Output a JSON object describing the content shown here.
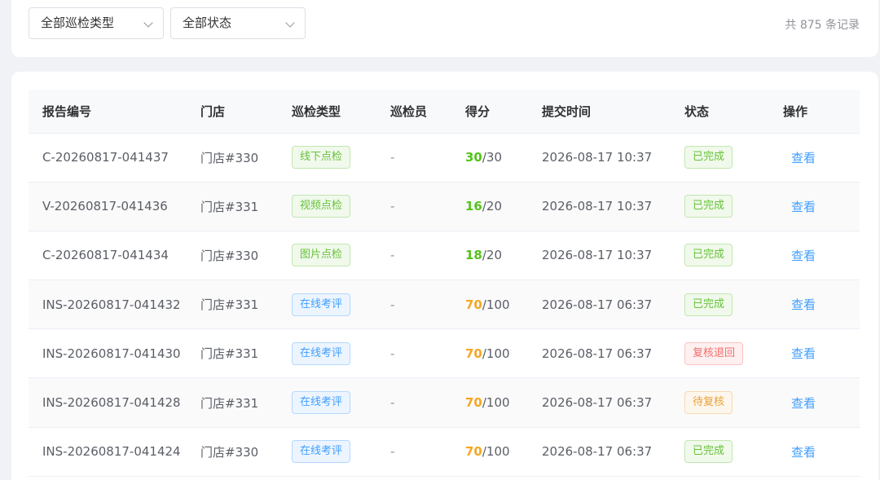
{
  "filters": {
    "type_select": "全部巡检类型",
    "status_select": "全部状态",
    "total_text": "共 875 条记录"
  },
  "table": {
    "headers": [
      "报告编号",
      "门店",
      "巡检类型",
      "巡检员",
      "得分",
      "提交时间",
      "状态",
      "操作"
    ],
    "rows": [
      {
        "id": "C-20260817-041437",
        "store": "门店#330",
        "type": "线下点检",
        "type_color": "green",
        "inspector": "-",
        "score": "30",
        "score_color": "green",
        "max": "/30",
        "time": "2026-08-17 10:37",
        "status": "已完成",
        "status_color": "green",
        "action": "查看"
      },
      {
        "id": "V-20260817-041436",
        "store": "门店#331",
        "type": "视频点检",
        "type_color": "green",
        "inspector": "-",
        "score": "16",
        "score_color": "green",
        "max": "/20",
        "time": "2026-08-17 10:37",
        "status": "已完成",
        "status_color": "green",
        "action": "查看"
      },
      {
        "id": "C-20260817-041434",
        "store": "门店#330",
        "type": "图片点检",
        "type_color": "green",
        "inspector": "-",
        "score": "18",
        "score_color": "green",
        "max": "/20",
        "time": "2026-08-17 10:37",
        "status": "已完成",
        "status_color": "green",
        "action": "查看"
      },
      {
        "id": "INS-20260817-041432",
        "store": "门店#331",
        "type": "在线考评",
        "type_color": "blue",
        "inspector": "-",
        "score": "70",
        "score_color": "orange",
        "max": "/100",
        "time": "2026-08-17 06:37",
        "status": "已完成",
        "status_color": "green",
        "action": "查看"
      },
      {
        "id": "INS-20260817-041430",
        "store": "门店#331",
        "type": "在线考评",
        "type_color": "blue",
        "inspector": "-",
        "score": "70",
        "score_color": "orange",
        "max": "/100",
        "time": "2026-08-17 06:37",
        "status": "复核退回",
        "status_color": "red",
        "action": "查看"
      },
      {
        "id": "INS-20260817-041428",
        "store": "门店#331",
        "type": "在线考评",
        "type_color": "blue",
        "inspector": "-",
        "score": "70",
        "score_color": "orange",
        "max": "/100",
        "time": "2026-08-17 06:37",
        "status": "待复核",
        "status_color": "yellow",
        "action": "查看"
      },
      {
        "id": "INS-20260817-041424",
        "store": "门店#330",
        "type": "在线考评",
        "type_color": "blue",
        "inspector": "-",
        "score": "70",
        "score_color": "orange",
        "max": "/100",
        "time": "2026-08-17 06:37",
        "status": "已完成",
        "status_color": "green",
        "action": "查看"
      }
    ]
  },
  "colors": {
    "link": "#409eff",
    "success": "#67c23a",
    "warning": "#e6a23c",
    "danger": "#f56c6c"
  }
}
